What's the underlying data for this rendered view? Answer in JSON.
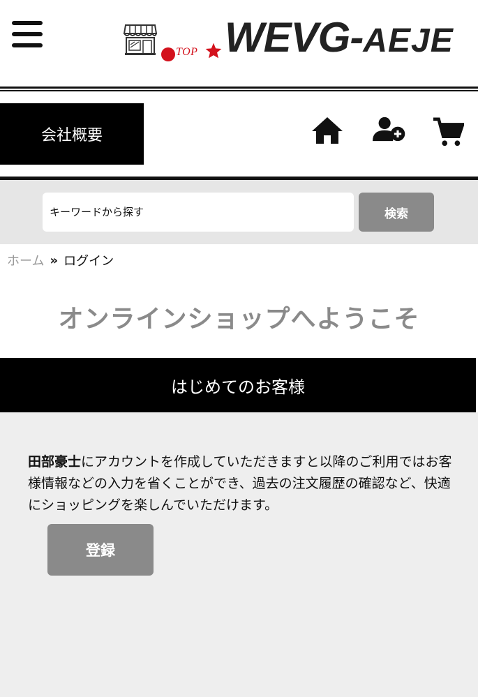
{
  "header": {
    "logo_top": "TOP",
    "logo_main": "WEVG-",
    "logo_suffix": "AEJE"
  },
  "nav": {
    "company_label": "会社概要",
    "icons": [
      "home-icon",
      "user-add-icon",
      "cart-icon"
    ]
  },
  "search": {
    "placeholder": "キーワードから探す",
    "button_label": "検索"
  },
  "breadcrumb": {
    "home": "ホーム",
    "separator": "»",
    "current": "ログイン"
  },
  "main": {
    "welcome": "オンラインショップへようこそ",
    "section_title": "はじめてのお客様",
    "shop_name": "田部豪士",
    "description": "にアカウントを作成していただきますと以降のご利用ではお客様情報などの入力を省くことができ、過去の注文履歴の確認など、快適にショッピングを楽しんでいただけます。",
    "register_label": "登録"
  },
  "colors": {
    "accent_red": "#d3121d",
    "button_gray": "#8a8a8a",
    "band_gray": "#e6e6e6",
    "panel_gray": "#eeeeee"
  }
}
